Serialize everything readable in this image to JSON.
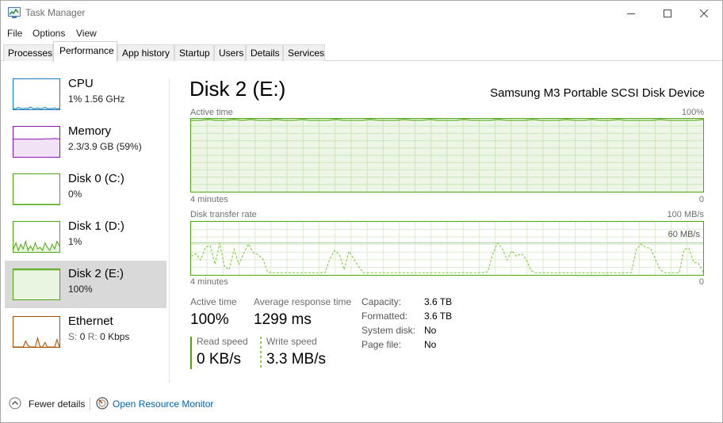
{
  "window": {
    "title": "Task Manager"
  },
  "icons": {
    "app": "task-manager-icon",
    "minimize": "minimize-icon",
    "maximize": "maximize-icon",
    "close": "close-icon",
    "fewer_details": "chevron-up-circle-icon",
    "resource_monitor": "resource-monitor-icon"
  },
  "menu": {
    "file": "File",
    "options": "Options",
    "view": "View"
  },
  "tabs": [
    {
      "label": "Processes"
    },
    {
      "label": "Performance"
    },
    {
      "label": "App history"
    },
    {
      "label": "Startup"
    },
    {
      "label": "Users"
    },
    {
      "label": "Details"
    },
    {
      "label": "Services"
    }
  ],
  "sidebar": {
    "items": [
      {
        "name": "CPU",
        "sub": "1%  1.56 GHz",
        "color": "#117dbb",
        "thumb_levels": [
          0.02,
          0.02,
          0.06,
          0.03,
          0.02,
          0.04,
          0.02,
          0.08,
          0.03,
          0.02,
          0.05,
          0.02,
          0.03,
          0.07,
          0.02,
          0.03,
          0.02,
          0.05,
          0.02,
          0.03
        ]
      },
      {
        "name": "Memory",
        "sub": "2.3/3.9 GB (59%)",
        "color": "#8b12ae",
        "thumb_levels": [
          0.59,
          0.59,
          0.59,
          0.59,
          0.59,
          0.59,
          0.59,
          0.59,
          0.59,
          0.59,
          0.59,
          0.59,
          0.59,
          0.6,
          0.6,
          0.6,
          0.6,
          0.61,
          0.6,
          0.6
        ]
      },
      {
        "name": "Disk 0 (C:)",
        "sub": "0%",
        "color": "#4da60c",
        "thumb_levels": [
          0,
          0,
          0,
          0,
          0,
          0,
          0,
          0,
          0,
          0,
          0,
          0,
          0,
          0,
          0,
          0,
          0,
          0,
          0,
          0
        ]
      },
      {
        "name": "Disk 1 (D:)",
        "sub": "1%",
        "color": "#4da60c",
        "thumb_levels": [
          0.1,
          0.3,
          0.05,
          0.25,
          0.1,
          0.35,
          0.05,
          0.2,
          0.05,
          0.3,
          0.1,
          0.15,
          0.05,
          0.3,
          0.15,
          0.05,
          0.25,
          0.1,
          0.35,
          0.2
        ]
      },
      {
        "name": "Disk 2 (E:)",
        "sub": "100%",
        "color": "#4da60c",
        "thumb_levels": [
          0.98,
          0.98,
          0.98,
          0.98,
          0.98,
          0.98,
          0.98,
          0.98,
          0.98,
          0.98,
          0.98,
          0.98,
          0.98,
          0.98,
          0.98,
          0.98,
          0.98,
          0.98,
          0.98,
          0.98
        ]
      },
      {
        "name": "Ethernet",
        "sub_s": "S:",
        "sub_s_val": "0",
        "sub_r": "R:",
        "sub_r_val": "0 Kbps",
        "color": "#a74f01",
        "thumb_levels": [
          0,
          0,
          0,
          0,
          0,
          0.2,
          0.05,
          0,
          0,
          0,
          0.3,
          0,
          0,
          0.15,
          0,
          0,
          0,
          0,
          0.25,
          0
        ]
      }
    ]
  },
  "main": {
    "title": "Disk 2 (E:)",
    "device": "Samsung M3 Portable SCSI Disk Device",
    "active_graph": {
      "label": "Active time",
      "max_label": "100%",
      "time_label": "4 minutes",
      "min_label": "0",
      "values": [
        98,
        98,
        99,
        98,
        98,
        99,
        98,
        99,
        98,
        98,
        99,
        98,
        98,
        99,
        98,
        98,
        98,
        99,
        98,
        98,
        98,
        99,
        98,
        98,
        98,
        99,
        98,
        98,
        99,
        98,
        98,
        98,
        99,
        98,
        98,
        98,
        99,
        98,
        98,
        98,
        99,
        98,
        98,
        98,
        99,
        98,
        98,
        99,
        98,
        98,
        99,
        98,
        98,
        98,
        98,
        99,
        98,
        98,
        98,
        98,
        99
      ]
    },
    "transfer_graph": {
      "label": "Disk transfer rate",
      "max_label": "100 MB/s",
      "mid_label": "60 MB/s",
      "time_label": "4 minutes",
      "min_label": "0",
      "max_value": 100,
      "mid_value": 60,
      "values": [
        35,
        40,
        28,
        52,
        55,
        20,
        60,
        15,
        10,
        48,
        20,
        40,
        58,
        42,
        38,
        30,
        5,
        4,
        4,
        4,
        4,
        4,
        4,
        4,
        4,
        4,
        4,
        4,
        4,
        30,
        46,
        38,
        10,
        44,
        30,
        16,
        4,
        4,
        4,
        4,
        4,
        4,
        4,
        4,
        4,
        4,
        4,
        4,
        4,
        4,
        4,
        4,
        4,
        4,
        4,
        4,
        4,
        4,
        4,
        4,
        4,
        4,
        6,
        38,
        60,
        50,
        28,
        45,
        35,
        40,
        30,
        8,
        4,
        4,
        4,
        4,
        4,
        4,
        4,
        4,
        4,
        4,
        4,
        4,
        4,
        4,
        4,
        4,
        4,
        4,
        4,
        4,
        4,
        48,
        58,
        52,
        50,
        30,
        10,
        4,
        4,
        4,
        4,
        48,
        50,
        24,
        22,
        5
      ]
    },
    "stats": {
      "active_time_label": "Active time",
      "active_time_value": "100%",
      "avg_response_label": "Average response time",
      "avg_response_value": "1299 ms",
      "read_speed_label": "Read speed",
      "read_speed_value": "0 KB/s",
      "write_speed_label": "Write speed",
      "write_speed_value": "3.3 MB/s"
    },
    "properties": [
      {
        "label": "Capacity:",
        "value": "3.6 TB"
      },
      {
        "label": "Formatted:",
        "value": "3.6 TB"
      },
      {
        "label": "System disk:",
        "value": "No"
      },
      {
        "label": "Page file:",
        "value": "No"
      }
    ]
  },
  "footer": {
    "fewer_details": "Fewer details",
    "resource_monitor": "Open Resource Monitor"
  }
}
